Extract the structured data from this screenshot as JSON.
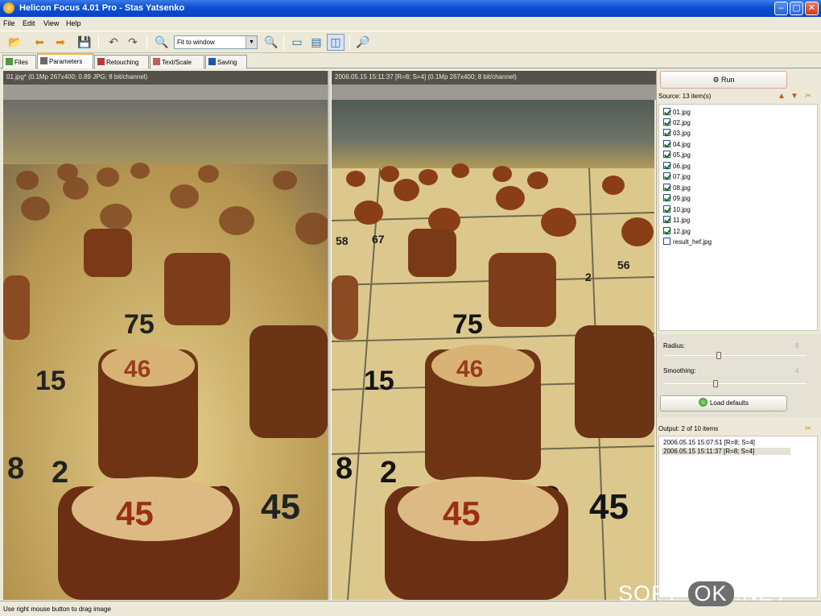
{
  "window": {
    "title": "Helicon Focus 4.01 Pro - Stas Yatsenko"
  },
  "menu": [
    "File",
    "Edit",
    "View",
    "Help"
  ],
  "toolbar": {
    "zoom_value": "Fit to window"
  },
  "tabs": [
    {
      "label": "Files",
      "icon": "files-icon",
      "active": false
    },
    {
      "label": "Parameters",
      "icon": "parameters-icon",
      "active": true
    },
    {
      "label": "Retouching",
      "icon": "retouching-icon",
      "active": false
    },
    {
      "label": "Text/Scale",
      "icon": "text-scale-icon",
      "active": false
    },
    {
      "label": "Saving",
      "icon": "saving-icon",
      "active": false
    }
  ],
  "left_pane": {
    "header": "01.jpg* (0.1Mp 267x400; 0.89 JPG; 8 bit/channel)"
  },
  "right_pane": {
    "header": "2006.05.15 15:11:37 [R=8; S=4] (0.1Mp 267x400; 8 bit/channel)"
  },
  "panel": {
    "run_label": "Run",
    "source_label": "Source: 13 item(s)",
    "source_items": [
      {
        "name": "01.jpg",
        "checked": true
      },
      {
        "name": "02.jpg",
        "checked": true
      },
      {
        "name": "03.jpg",
        "checked": true
      },
      {
        "name": "04.jpg",
        "checked": true
      },
      {
        "name": "05.jpg",
        "checked": true
      },
      {
        "name": "06.jpg",
        "checked": true
      },
      {
        "name": "07.jpg",
        "checked": true
      },
      {
        "name": "08.jpg",
        "checked": true
      },
      {
        "name": "09.jpg",
        "checked": true
      },
      {
        "name": "10.jpg",
        "checked": true
      },
      {
        "name": "11.jpg",
        "checked": true
      },
      {
        "name": "12.jpg",
        "checked": true
      },
      {
        "name": "result_hef.jpg",
        "checked": false
      }
    ],
    "radius_label": "Radius:",
    "radius_value": "8",
    "radius_level": 0.38,
    "smoothing_label": "Smoothing:",
    "smoothing_value": "4",
    "smoothing_level": 0.36,
    "load_defaults_label": "Load defaults",
    "output_label": "Output: 2 of 10 items",
    "output_items": [
      {
        "text": "2006.05.15 15:07:51 [R=8; S=4]",
        "selected": false
      },
      {
        "text": "2006.05.15 15:11:37 [R=8; S=4]",
        "selected": true
      }
    ]
  },
  "status": {
    "text": "Use right mouse button to drag image"
  },
  "watermark": {
    "part1": "SOFT-",
    "part2": "OK",
    "part3": ".NET"
  },
  "colors": {
    "titlebar": "#0a4fd3",
    "accent_tab": "#f5b53f"
  }
}
